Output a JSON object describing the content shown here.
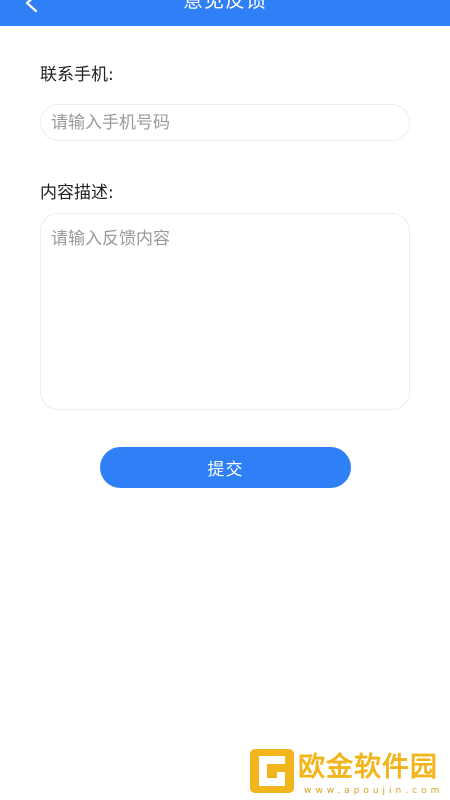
{
  "header": {
    "title": "意见反馈",
    "color": "#2f7ff6"
  },
  "form": {
    "phone_label": "联系手机:",
    "phone_placeholder": "请输入手机号码",
    "description_label": "内容描述:",
    "description_placeholder": "请输入反馈内容",
    "submit_label": "提交"
  },
  "watermark": {
    "name": "欧金软件园",
    "url": "www.apoujin.com"
  },
  "icons": {
    "back": "chevron-left-icon",
    "watermark_logo": "apoujin-logo-icon"
  }
}
